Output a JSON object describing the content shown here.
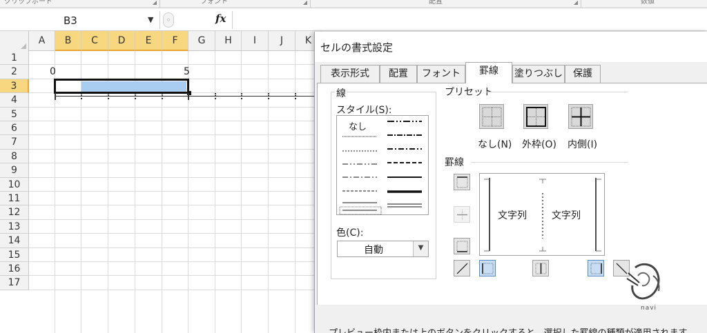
{
  "ribbon": {
    "groups": [
      "クリップボード",
      "フォント",
      "配置",
      "数値"
    ]
  },
  "formula_bar": {
    "name_box": "B3",
    "fx_label": "fx",
    "value": ""
  },
  "sheet": {
    "columns": [
      "A",
      "B",
      "C",
      "D",
      "E",
      "F",
      "G",
      "H",
      "I",
      "J",
      "K"
    ],
    "rows": [
      "1",
      "2",
      "3",
      "4",
      "5",
      "6",
      "7",
      "8",
      "9",
      "10",
      "11",
      "12",
      "13",
      "14",
      "15",
      "16",
      "17"
    ],
    "cells": {
      "B2": "0",
      "F2": "5"
    },
    "selection_fill": "#a8cdf0"
  },
  "dialog": {
    "title": "セルの書式設定",
    "tabs": [
      "表示形式",
      "配置",
      "フォント",
      "罫線",
      "塗りつぶし",
      "保護"
    ],
    "active_tab": "罫線",
    "line_group_label": "線",
    "style_label": "スタイル(S):",
    "style_none": "なし",
    "color_label": "色(C):",
    "color_value": "自動",
    "preset_label": "プリセット",
    "presets": [
      "なし(N)",
      "外枠(O)",
      "内側(I)"
    ],
    "border_label": "罫線",
    "preview_text": [
      "文字列",
      "文字列"
    ],
    "footer": "プレビュー枠内または上のボタンをクリックすると、選択した罫線の種類が適用されます。"
  },
  "watermark": {
    "text": "navi"
  }
}
